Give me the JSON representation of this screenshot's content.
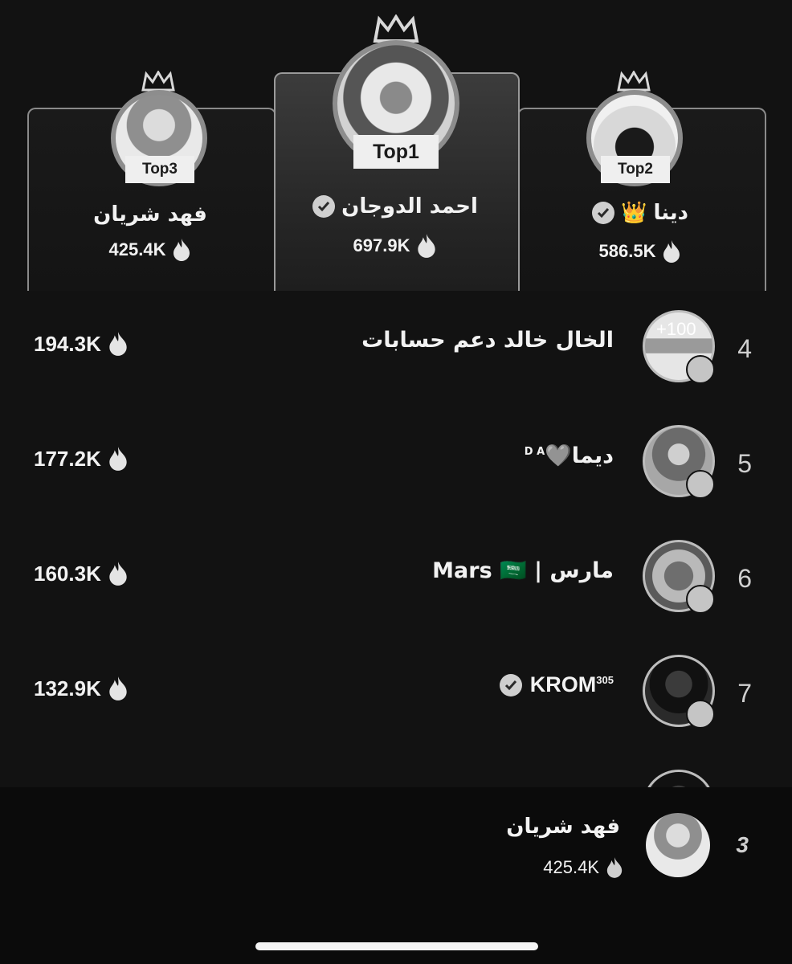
{
  "podium": [
    {
      "position": "second",
      "label": "Top2",
      "name": "دينا",
      "emoji": "👑",
      "verified": true,
      "score": "586.5K"
    },
    {
      "position": "first",
      "label": "Top1",
      "name": "احمد الدوجان",
      "verified": true,
      "score": "697.9K"
    },
    {
      "position": "third",
      "label": "Top3",
      "name": "فهد شريان",
      "verified": false,
      "score": "425.4K"
    }
  ],
  "list": [
    {
      "rank": "4",
      "name": "الخال خالد دعم حسابات",
      "score": "194.3K",
      "avatar_text": "+100"
    },
    {
      "rank": "5",
      "name": "ديما🩶",
      "sup": "D A",
      "score": "177.2K"
    },
    {
      "rank": "6",
      "name": "مارس | Mars 🇸🇦",
      "score": "160.3K"
    },
    {
      "rank": "7",
      "name": "KROM",
      "sup": "305",
      "verified": true,
      "score": "132.9K"
    }
  ],
  "current_user": {
    "rank": "3",
    "name": "فهد شريان",
    "score": "425.4K"
  },
  "icons": [
    "crown-icon",
    "flame-icon",
    "verified-icon",
    "live-icon"
  ]
}
